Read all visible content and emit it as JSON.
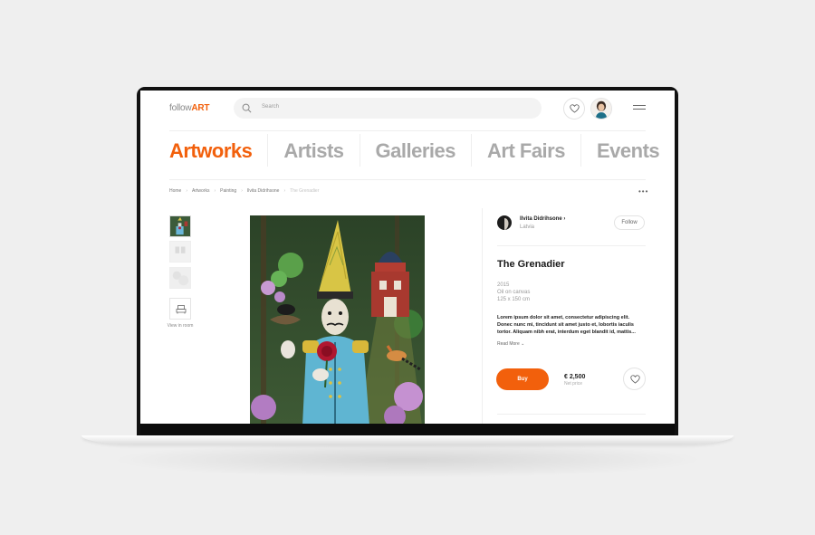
{
  "header": {
    "logo_prefix": "follow",
    "logo_suffix": "ART",
    "search_placeholder": "Search"
  },
  "categories": [
    "Artworks",
    "Artists",
    "Galleries",
    "Art Fairs",
    "Events"
  ],
  "breadcrumb": [
    "Home",
    "Artworks",
    "Painting",
    "Ilvita Didrihsone",
    "The Grenadier"
  ],
  "thumbnails": {
    "view_in_room_label": "View in room"
  },
  "artist": {
    "name": "Ilvita Didrihsone",
    "country": "Latvia",
    "follow_label": "Follow"
  },
  "artwork": {
    "title": "The Grenadier",
    "year": "2015",
    "medium": "Oil on canvas",
    "size": "125 x 150 cm",
    "description": "Lorem ipsum dolor sit amet, consectetur adipiscing elit. Donec nunc mi, tincidunt sit amet justo et, lobortis iaculis tortor. Aliquam nibh erat, interdum eget blandit id, mattis...",
    "read_more": "Read More"
  },
  "purchase": {
    "buy_label": "Buy",
    "price": "€ 2,500",
    "price_note": "Net price"
  },
  "colors": {
    "accent": "#f2600c",
    "inactive_category": "#a9a9a9"
  }
}
